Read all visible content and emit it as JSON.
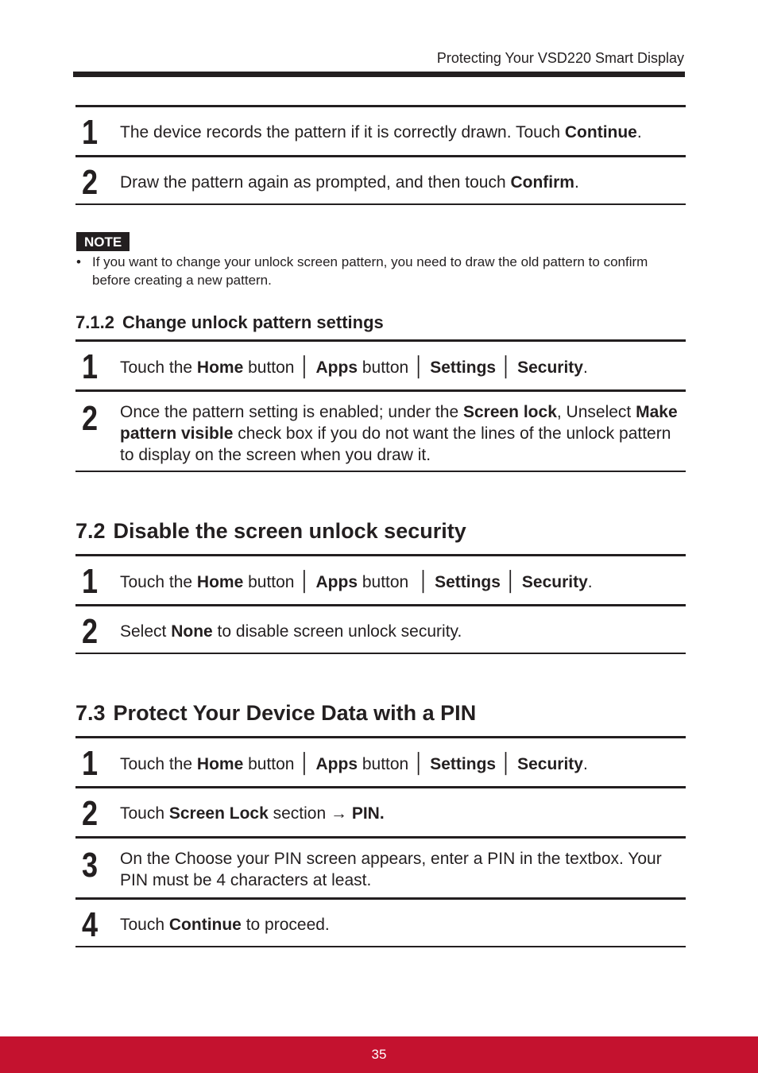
{
  "header": {
    "running_title": "Protecting Your VSD220 Smart Display"
  },
  "section_a": {
    "steps": [
      {
        "num": "1",
        "parts": [
          {
            "t": "The device records the pattern if it is correctly drawn. Touch "
          },
          {
            "t": "Continue",
            "b": true
          },
          {
            "t": "."
          }
        ]
      },
      {
        "num": "2",
        "parts": [
          {
            "t": "Draw the pattern again as prompted, and then touch "
          },
          {
            "t": "Confirm",
            "b": true
          },
          {
            "t": "."
          }
        ]
      }
    ]
  },
  "note": {
    "label": "NOTE",
    "bullet": "•",
    "items": [
      "If you want to change your unlock screen pattern, you need to draw the old pattern to confirm before creating a new pattern."
    ]
  },
  "section_712": {
    "number": "7.1.2",
    "title": "Change unlock pattern settings",
    "steps": [
      {
        "num": "1",
        "parts": [
          {
            "t": "Touch the "
          },
          {
            "t": "Home",
            "b": true
          },
          {
            "t": " button"
          },
          {
            "sep": "│"
          },
          {
            "t": "Apps",
            "b": true
          },
          {
            "t": " button"
          },
          {
            "sep": "│"
          },
          {
            "t": "Settings",
            "b": true
          },
          {
            "sep": "│"
          },
          {
            "t": "Security",
            "b": true
          },
          {
            "t": "."
          }
        ]
      },
      {
        "num": "2",
        "parts": [
          {
            "t": "Once the pattern setting is enabled; under the "
          },
          {
            "t": "Screen lock",
            "b": true
          },
          {
            "t": ", Unselect "
          },
          {
            "t": "Make pattern visible",
            "b": true
          },
          {
            "t": " check box if you do not want the lines of the unlock pattern to display on the screen when you draw it."
          }
        ]
      }
    ]
  },
  "section_72": {
    "number": "7.2",
    "title": "Disable the screen unlock security",
    "steps": [
      {
        "num": "1",
        "parts": [
          {
            "t": "Touch the "
          },
          {
            "t": "Home",
            "b": true
          },
          {
            "t": " button"
          },
          {
            "sep": "│"
          },
          {
            "t": "Apps",
            "b": true
          },
          {
            "t": " button "
          },
          {
            "sep": "│"
          },
          {
            "t": "Settings",
            "b": true
          },
          {
            "sep": "│"
          },
          {
            "t": "Security",
            "b": true
          },
          {
            "t": "."
          }
        ]
      },
      {
        "num": "2",
        "parts": [
          {
            "t": "Select "
          },
          {
            "t": "None",
            "b": true
          },
          {
            "t": " to disable screen unlock security."
          }
        ]
      }
    ]
  },
  "section_73": {
    "number": "7.3",
    "title": "Protect Your Device Data with a PIN",
    "steps": [
      {
        "num": "1",
        "parts": [
          {
            "t": "Touch the "
          },
          {
            "t": "Home",
            "b": true
          },
          {
            "t": " button"
          },
          {
            "sep": "│"
          },
          {
            "t": "Apps",
            "b": true
          },
          {
            "t": " button"
          },
          {
            "sep": "│"
          },
          {
            "t": "Settings",
            "b": true
          },
          {
            "sep": "│"
          },
          {
            "t": "Security",
            "b": true
          },
          {
            "t": "."
          }
        ]
      },
      {
        "num": "2",
        "parts": [
          {
            "t": "Touch "
          },
          {
            "t": "Screen Lock",
            "b": true
          },
          {
            "t": " section → "
          },
          {
            "t": "PIN.",
            "b": true
          }
        ]
      },
      {
        "num": "3",
        "parts": [
          {
            "t": "On the Choose your PIN screen appears, enter a PIN in the textbox. Your PIN must be 4 characters at least."
          }
        ]
      },
      {
        "num": "4",
        "parts": [
          {
            "t": "Touch "
          },
          {
            "t": "Continue",
            "b": true
          },
          {
            "t": " to proceed."
          }
        ]
      }
    ]
  },
  "footer": {
    "page_number": "35",
    "color": "#c4122f"
  }
}
